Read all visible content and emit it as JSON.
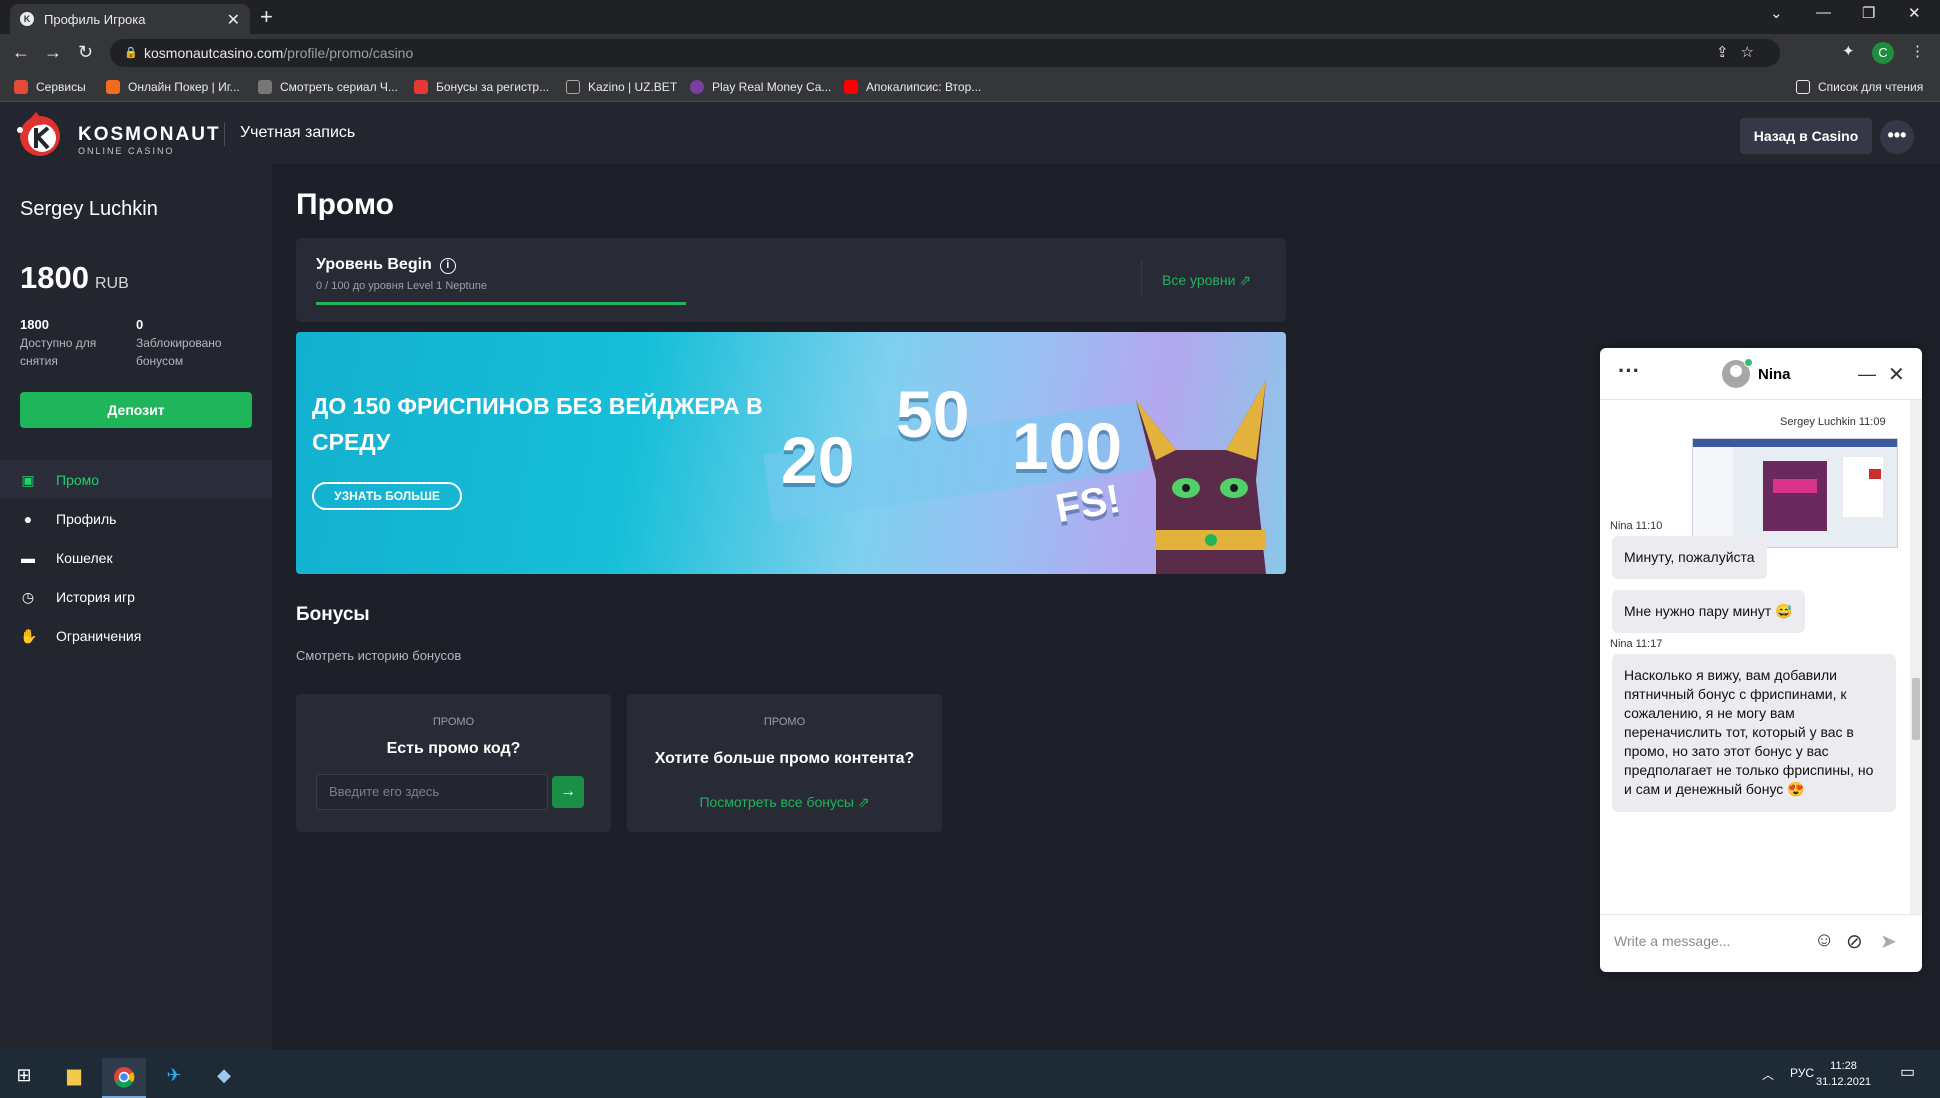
{
  "browser": {
    "tab_title": "Профиль Игрока",
    "url_host": "kosmonautcasino.com",
    "url_path": "/profile/promo/casino",
    "profile_initial": "C",
    "bookmarks": [
      {
        "label": "Сервисы",
        "color": "#e34a3a"
      },
      {
        "label": "Онлайн Покер | Иг...",
        "color": "#f36b1c"
      },
      {
        "label": "Смотреть сериал Ч...",
        "color": "#777777"
      },
      {
        "label": "Бонусы за регистр...",
        "color": "#e53935"
      },
      {
        "label": "Kazino | UZ.BET",
        "color": "#333333"
      },
      {
        "label": "Play Real Money Ca...",
        "color": "#7b3fa0"
      },
      {
        "label": "Апокалипсис: Втор...",
        "color": "#ff0000"
      }
    ],
    "reading_list": "Список для чтения"
  },
  "header": {
    "brand": "KOSMONAUT",
    "brand_sub": "ONLINE CASINO",
    "account": "Учетная запись",
    "back_button": "Назад в Casino",
    "more_button": "•••"
  },
  "sidebar": {
    "username": "Sergey Luchkin",
    "balance": "1800",
    "currency": "RUB",
    "available_value": "1800",
    "available_label": "Доступно для снятия",
    "blocked_value": "0",
    "blocked_label": "Заблокировано бонусом",
    "deposit_button": "Депозит",
    "menu": [
      {
        "label": "Промо",
        "icon": "gift-icon"
      },
      {
        "label": "Профиль",
        "icon": "user-icon"
      },
      {
        "label": "Кошелек",
        "icon": "wallet-icon"
      },
      {
        "label": "История игр",
        "icon": "clock-icon"
      },
      {
        "label": "Ограничения",
        "icon": "hand-icon"
      }
    ]
  },
  "main": {
    "title": "Промо",
    "level_title": "Уровень Begin",
    "level_progress_text": "0 / 100 до уровня Level 1 Neptune",
    "level_progress": 0,
    "all_levels": "Все уровни",
    "banner_title": "ДО 150 ФРИСПИНОВ БЕЗ ВЕЙДЖЕРА В СРЕДУ",
    "banner_button": "УЗНАТЬ БОЛЬШЕ",
    "banner_numbers": [
      "20",
      "50",
      "100"
    ],
    "banner_fs": "FS!",
    "bonuses_title": "Бонусы",
    "bonus_history": "Смотреть историю бонусов",
    "promo_card": {
      "label": "ПРОМО",
      "title": "Есть промо код?",
      "placeholder": "Введите его здесь"
    },
    "content_card": {
      "label": "ПРОМО",
      "title": "Хотите больше промо контента?",
      "link": "Посмотреть все бонусы"
    }
  },
  "chat": {
    "agent": "Nina",
    "user_meta": "Sergey Luchkin 11:09",
    "meta_1": "Nina 11:10",
    "msg_1": "Минуту, пожалуйста",
    "msg_2": "Мне нужно пару минут 😅",
    "meta_2": "Nina 11:17",
    "msg_3": "Насколько я вижу, вам добавили пятничный бонус с фриспинами, к сожалению, я не могу вам переначислить тот, который у вас в промо, но зато этот бонус у вас предполагает не только фриспины, но и сам и денежный бонус 😍",
    "placeholder": "Write a message..."
  },
  "taskbar": {
    "lang": "РУС",
    "time": "11:28",
    "date": "31.12.2021"
  },
  "colors": {
    "accent_green": "#1fb55b",
    "page_bg": "#1e2029",
    "panel_bg": "#23252f"
  }
}
